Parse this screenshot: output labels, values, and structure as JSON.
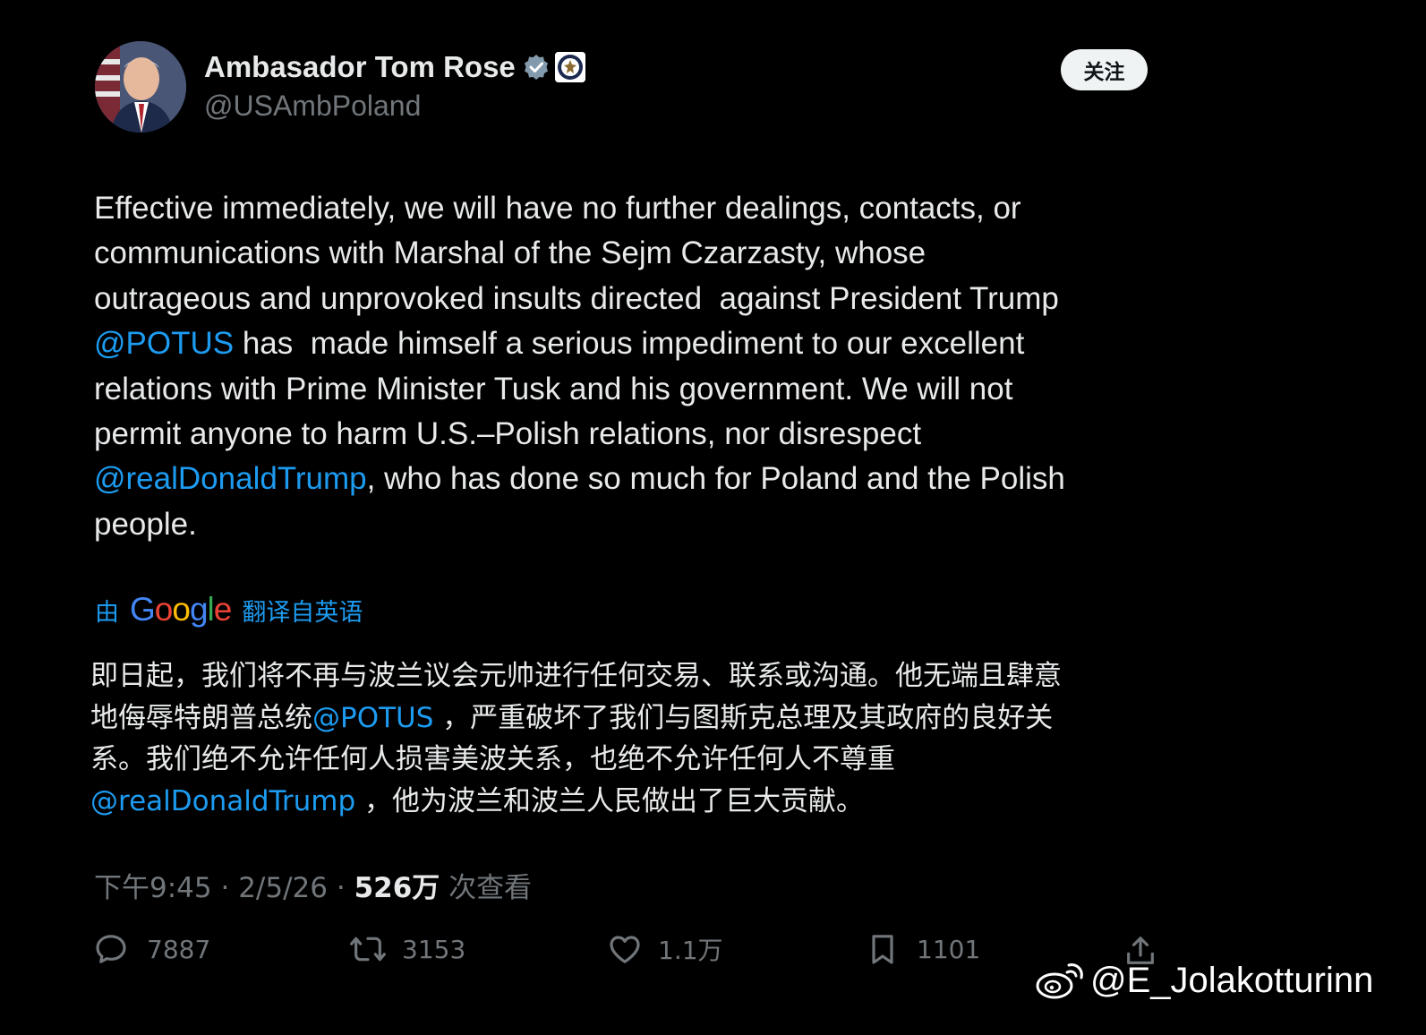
{
  "author": {
    "display_name": "Ambasador Tom Rose",
    "handle": "@USAmbPoland",
    "verified_icon": "verified-badge-icon",
    "affiliation_icon": "us-department-of-state-seal-icon"
  },
  "follow_label": "关注",
  "tweet": {
    "lines": [
      [
        {
          "text": "Effective immediately, we will have no further dealings, contacts, or",
          "mention": false
        }
      ],
      [
        {
          "text": "communications with Marshal of the Sejm Czarzasty, whose",
          "mention": false
        }
      ],
      [
        {
          "text": "outrageous and unprovoked insults directed  against President Trump",
          "mention": false
        }
      ],
      [
        {
          "text": "@POTUS",
          "mention": true
        },
        {
          "text": " has  made himself a serious impediment to our excellent",
          "mention": false
        }
      ],
      [
        {
          "text": "relations with Prime Minister Tusk and his government. We will not",
          "mention": false
        }
      ],
      [
        {
          "text": "permit anyone to harm U.S.–Polish relations, nor disrespect",
          "mention": false
        }
      ],
      [
        {
          "text": "@realDonaldTrump",
          "mention": true
        },
        {
          "text": ", who has done so much for Poland and the Polish",
          "mention": false
        }
      ],
      [
        {
          "text": "people.",
          "mention": false
        }
      ]
    ]
  },
  "translation": {
    "prefix": "由",
    "google": "Google",
    "suffix": "翻译自英语",
    "lines": [
      [
        {
          "text": "即日起，我们将不再与波兰议会元帅进行任何交易、联系或沟通。他无端且肆意",
          "mention": false
        }
      ],
      [
        {
          "text": "地侮辱特朗普总统",
          "mention": false
        },
        {
          "text": "@POTUS",
          "mention": true
        },
        {
          "text": " ，严重破坏了我们与图斯克总理及其政府的良好关",
          "mention": false
        }
      ],
      [
        {
          "text": "系。我们绝不允许任何人损害美波关系，也绝不允许任何人不尊重",
          "mention": false
        }
      ],
      [
        {
          "text": "@realDonaldTrump",
          "mention": true
        },
        {
          "text": " ，他为波兰和波兰人民做出了巨大贡献。",
          "mention": false
        }
      ]
    ]
  },
  "meta": {
    "time": "下午9:45",
    "date": "2/5/26",
    "views_count": "526万",
    "views_label": "次查看"
  },
  "actions": {
    "replies": "7887",
    "reposts": "3153",
    "likes": "1.1万",
    "bookmarks": "1101"
  },
  "watermark": "@E_Jolakotturinn",
  "colors": {
    "background": "#000000",
    "text": "#e7e9ea",
    "secondary": "#71767b",
    "accent": "#1d9bf0"
  }
}
